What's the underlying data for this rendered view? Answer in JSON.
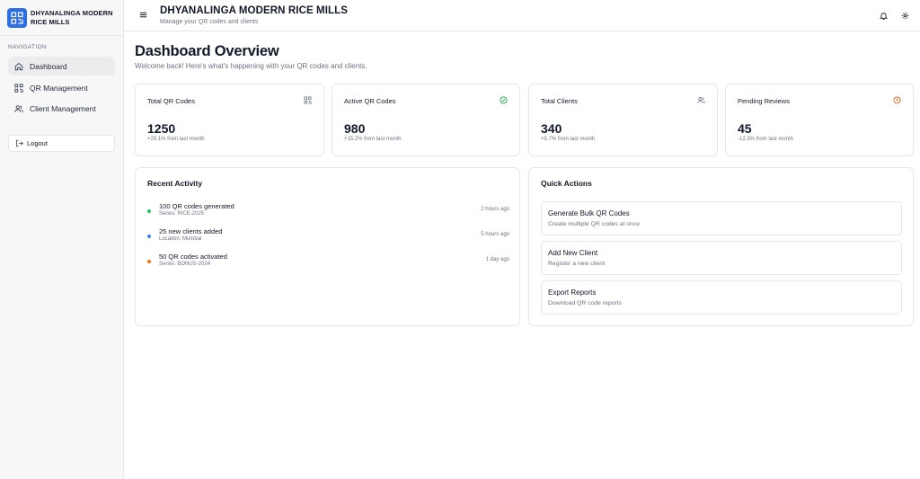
{
  "brand": {
    "name": "DHYANALINGA MODERN RICE MILLS"
  },
  "sidebar": {
    "heading": "NAVIGATION",
    "items": [
      {
        "label": "Dashboard",
        "icon": "home-icon",
        "active": true
      },
      {
        "label": "QR Management",
        "icon": "qr-icon",
        "active": false
      },
      {
        "label": "Client Management",
        "icon": "users-icon",
        "active": false
      }
    ],
    "logout_label": "Logout"
  },
  "header": {
    "title": "DHYANALINGA MODERN RICE MILLS",
    "subtitle": "Manage your QR codes and clients",
    "icons": [
      "menu-icon",
      "bell-icon",
      "gear-icon"
    ]
  },
  "main": {
    "title": "Dashboard Overview",
    "subtitle": "Welcome back! Here's what's happening with your QR codes and clients.",
    "stats": [
      {
        "label": "Total QR Codes",
        "value": "1250",
        "change": "+20.1% from last month",
        "icon": "qr-icon",
        "icon_color": "#6b7280"
      },
      {
        "label": "Active QR Codes",
        "value": "980",
        "change": "+15.2% from last month",
        "icon": "check-circle-icon",
        "icon_color": "#16a34a"
      },
      {
        "label": "Total Clients",
        "value": "340",
        "change": "+5.7% from last month",
        "icon": "users-icon",
        "icon_color": "#6b7280"
      },
      {
        "label": "Pending Reviews",
        "value": "45",
        "change": "-12.3% from last month",
        "icon": "clock-icon",
        "icon_color": "#ea580c"
      }
    ],
    "recent_activity": {
      "title": "Recent Activity",
      "items": [
        {
          "title": "100 QR codes generated",
          "sub": "Series: RICE-2025",
          "time": "2 hours ago",
          "dot_color": "#22c55e"
        },
        {
          "title": "25 new clients added",
          "sub": "Location: Mumbai",
          "time": "5 hours ago",
          "dot_color": "#3b82f6"
        },
        {
          "title": "50 QR codes activated",
          "sub": "Series: BONUS-2024",
          "time": "1 day ago",
          "dot_color": "#f97316"
        }
      ]
    },
    "quick_actions": {
      "title": "Quick Actions",
      "items": [
        {
          "title": "Generate Bulk QR Codes",
          "sub": "Create multiple QR codes at once"
        },
        {
          "title": "Add New Client",
          "sub": "Register a new client"
        },
        {
          "title": "Export Reports",
          "sub": "Download QR code reports"
        }
      ]
    }
  },
  "colors": {
    "brand": "#2f6fe4",
    "border": "#e5e7eb",
    "sidebar_bg": "#f7f7f8"
  }
}
